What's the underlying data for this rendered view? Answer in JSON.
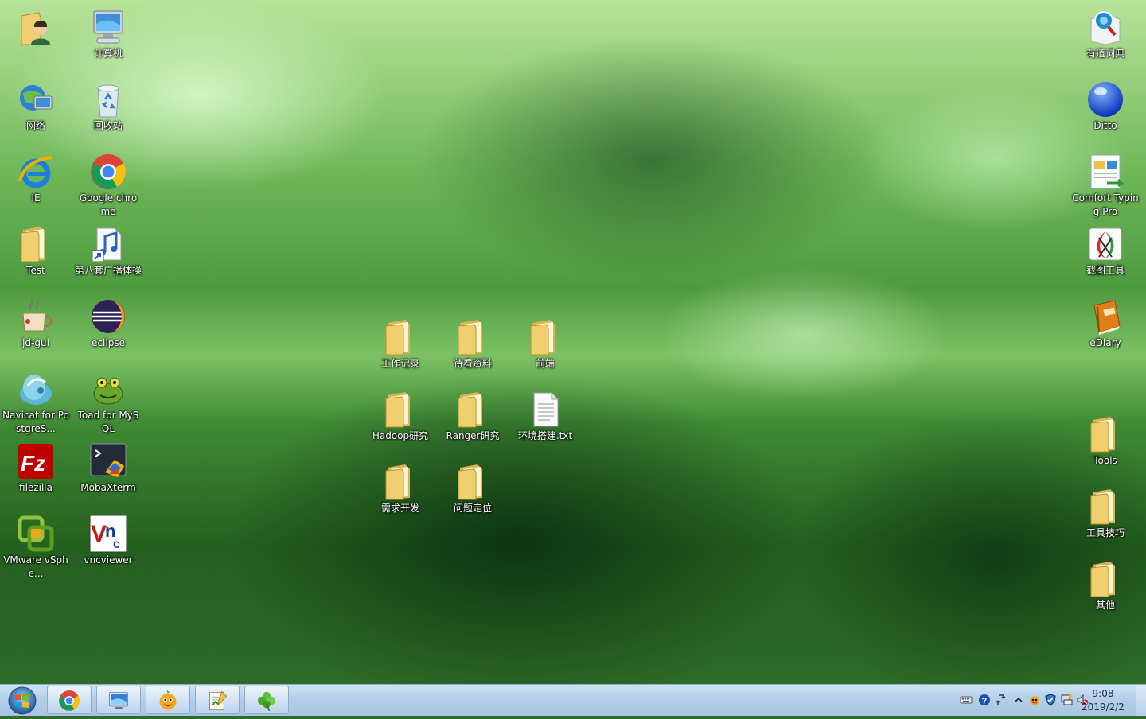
{
  "desktop": {
    "left_column": [
      {
        "label": "",
        "icon": "user-folder-icon"
      },
      {
        "label": "计算机",
        "icon": "computer-icon"
      },
      {
        "label": "网络",
        "icon": "network-icon"
      },
      {
        "label": "回收站",
        "icon": "recycle-bin-icon"
      },
      {
        "label": "IE",
        "icon": "internet-explorer-icon"
      },
      {
        "label": "Google chrome",
        "icon": "chrome-icon"
      },
      {
        "label": "Test",
        "icon": "folder-icon"
      },
      {
        "label": "第八套广播体操",
        "icon": "music-file-icon"
      },
      {
        "label": "jd-gui",
        "icon": "coffee-cup-icon"
      },
      {
        "label": "eclipse",
        "icon": "eclipse-icon"
      },
      {
        "label": "Navicat for PostgreS...",
        "icon": "navicat-icon"
      },
      {
        "label": "Toad for MySQL",
        "icon": "toad-icon"
      },
      {
        "label": "filezilla",
        "icon": "filezilla-icon"
      },
      {
        "label": "MobaXterm",
        "icon": "mobaxterm-icon"
      },
      {
        "label": "VMware vSphe...",
        "icon": "vmware-icon"
      },
      {
        "label": "vncviewer",
        "icon": "vnc-icon"
      }
    ],
    "center_group": [
      {
        "label": "工作记录",
        "icon": "folder-icon"
      },
      {
        "label": "待看资料",
        "icon": "folder-icon"
      },
      {
        "label": "前端",
        "icon": "folder-icon"
      },
      {
        "label": "Hadoop研究",
        "icon": "folder-icon"
      },
      {
        "label": "Ranger研究",
        "icon": "folder-icon"
      },
      {
        "label": "环境搭建.txt",
        "icon": "text-file-icon"
      },
      {
        "label": "需求开发",
        "icon": "folder-icon"
      },
      {
        "label": "问题定位",
        "icon": "folder-icon"
      }
    ],
    "right_column": [
      {
        "label": "有道词典",
        "icon": "youdao-dictionary-icon"
      },
      {
        "label": "Ditto",
        "icon": "ditto-icon"
      },
      {
        "label": "Comfort Typing Pro",
        "icon": "comfort-typing-icon"
      },
      {
        "label": "截图工具",
        "icon": "snipping-tool-icon"
      },
      {
        "label": "eDiary",
        "icon": "ediary-icon"
      },
      {
        "label": "Tools",
        "icon": "folder-icon"
      },
      {
        "label": "工具技巧",
        "icon": "folder-icon"
      },
      {
        "label": "其他",
        "icon": "folder-icon"
      }
    ]
  },
  "taskbar": {
    "start_icon": "windows-start-icon",
    "pinned": [
      "chrome-icon",
      "remote-desktop-icon",
      "qq-pet-icon",
      "notepad-icon",
      "clover-icon"
    ],
    "tray": [
      "keyboard-icon",
      "help-icon",
      "network-switch-icon",
      "expand-arrow-icon",
      "qq-icon",
      "shield-icon",
      "network-icon",
      "volume-muted-icon"
    ],
    "clock": {
      "time": "9:08",
      "date": "2019/2/2"
    }
  }
}
